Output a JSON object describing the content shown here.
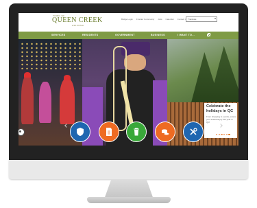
{
  "site": {
    "logo": {
      "top_line": "TOWN OF",
      "name": "QUEEN CREEK",
      "sub_line": "ARIZONA"
    },
    "utility_links": [
      "Bridge Login",
      "Frontier Community",
      "Jobs",
      "Calendar",
      "Contact Us"
    ],
    "language_select": {
      "value": "Translate"
    }
  },
  "nav": {
    "items": [
      "SERVICES",
      "RESIDENTS",
      "GOVERNMENT",
      "BUSINESS",
      "I WANT TO..."
    ]
  },
  "hero": {
    "caption": {
      "title": "Celebrate the holidays in QC",
      "text": "From shopping to events, ensure your seasonal joy this year in QC!"
    },
    "slides_total": 6,
    "slide_active": 5
  },
  "quick_links": [
    {
      "icon": "shield-icon",
      "color": "#1f66b0"
    },
    {
      "icon": "document-icon",
      "color": "#ee6b22"
    },
    {
      "icon": "trash-icon",
      "color": "#3aa83a"
    },
    {
      "icon": "coins-icon",
      "color": "#ee6b22"
    },
    {
      "icon": "tools-icon",
      "color": "#1f66b0"
    }
  ],
  "colors": {
    "nav_green": "#7f9b45",
    "logo_olive": "#6b7d2e"
  }
}
